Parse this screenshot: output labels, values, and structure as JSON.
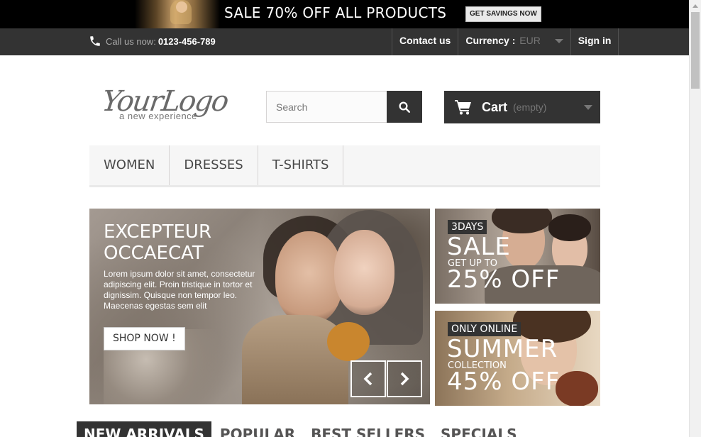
{
  "promo_bar": {
    "text": "SALE 70% OFF ALL PRODUCTS",
    "button": "GET SAVINGS NOW"
  },
  "nav": {
    "call_label": "Call us now:",
    "phone": "0123-456-789",
    "contact": "Contact us",
    "currency_label": "Currency :",
    "currency_value": "EUR",
    "signin": "Sign in"
  },
  "header": {
    "logo_script": "YourLogo",
    "logo_tagline": "a new experience",
    "search_placeholder": "Search",
    "cart_label": "Cart",
    "cart_status": "(empty)"
  },
  "menu": [
    "WOMEN",
    "DRESSES",
    "T-SHIRTS"
  ],
  "slider": {
    "title": "EXCEPTEUR OCCAECAT",
    "text": "Lorem ipsum dolor sit amet, consectetur adipiscing elit. Proin tristique in tortor et dignissim. Quisque non tempor leo. Maecenas egestas sem elit",
    "button": "SHOP NOW !"
  },
  "side_promos": [
    {
      "tag": "3DAYS",
      "big": "SALE",
      "small": "GET UP TO",
      "discount": "25% OFF"
    },
    {
      "tag": "ONLY ONLINE",
      "big": "SUMMER",
      "small": "COLLECTION",
      "discount": "45% OFF"
    }
  ],
  "tabs": [
    "NEW ARRIVALS",
    "POPULAR",
    "BEST SELLERS",
    "SPECIALS"
  ],
  "colors": {
    "dark": "#333333",
    "promo_bg": "#000000"
  },
  "icons": [
    "phone-icon",
    "search-icon",
    "cart-icon",
    "chevron-left-icon",
    "chevron-right-icon",
    "caret-down-icon"
  ]
}
